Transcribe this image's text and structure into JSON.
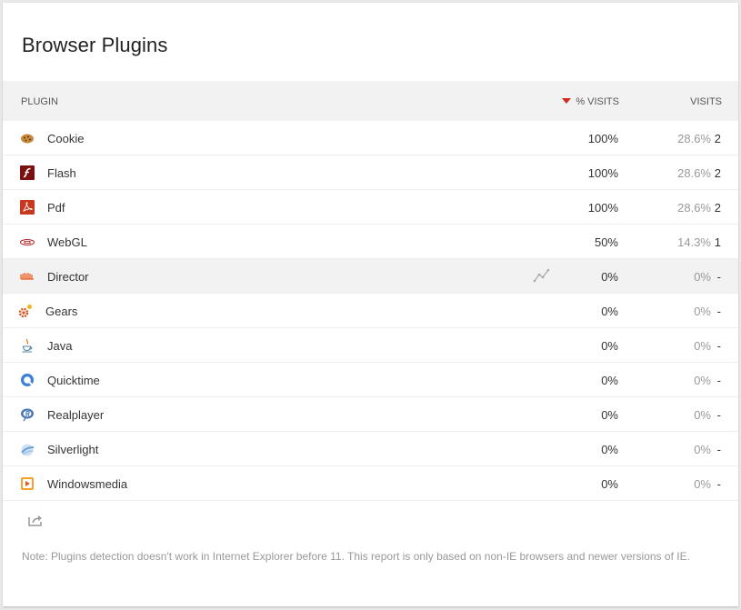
{
  "widget": {
    "title": "Browser Plugins",
    "note": "Note: Plugins detection doesn't work in Internet Explorer before 11. This report is only based on non-IE browsers and newer versions of IE."
  },
  "table": {
    "columns": {
      "plugin": "PLUGIN",
      "pct_visits": "% VISITS",
      "visits": "VISITS"
    },
    "sort_indicator_color": "#d4291f",
    "rows": [
      {
        "name": "Cookie",
        "icon": "cookie-icon",
        "pct": "100%",
        "ratio": "28.6%",
        "visits": "2"
      },
      {
        "name": "Flash",
        "icon": "flash-icon",
        "pct": "100%",
        "ratio": "28.6%",
        "visits": "2"
      },
      {
        "name": "Pdf",
        "icon": "pdf-icon",
        "pct": "100%",
        "ratio": "28.6%",
        "visits": "2"
      },
      {
        "name": "WebGL",
        "icon": "webgl-icon",
        "pct": "50%",
        "ratio": "14.3%",
        "visits": "1"
      },
      {
        "name": "Director",
        "icon": "director-icon",
        "pct": "0%",
        "ratio": "0%",
        "visits": "-"
      },
      {
        "name": "Gears",
        "icon": "gears-icon",
        "pct": "0%",
        "ratio": "0%",
        "visits": "-"
      },
      {
        "name": "Java",
        "icon": "java-icon",
        "pct": "0%",
        "ratio": "0%",
        "visits": "-"
      },
      {
        "name": "Quicktime",
        "icon": "quicktime-icon",
        "pct": "0%",
        "ratio": "0%",
        "visits": "-"
      },
      {
        "name": "Realplayer",
        "icon": "realplayer-icon",
        "pct": "0%",
        "ratio": "0%",
        "visits": "-"
      },
      {
        "name": "Silverlight",
        "icon": "silverlight-icon",
        "pct": "0%",
        "ratio": "0%",
        "visits": "-"
      },
      {
        "name": "Windowsmedia",
        "icon": "windowsmedia-icon",
        "pct": "0%",
        "ratio": "0%",
        "visits": "-"
      }
    ]
  }
}
